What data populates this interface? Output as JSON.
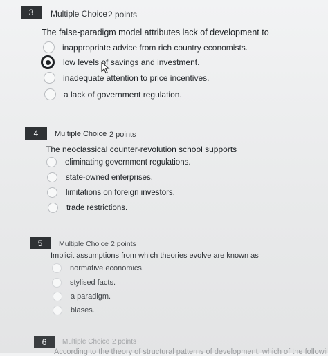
{
  "questions": [
    {
      "number": "3",
      "type": "Multiple Choice",
      "points": "2 points",
      "text": "The false-paradigm model attributes lack of development to",
      "options": [
        "inappropriate advice from rich country economists.",
        "low levels of savings and investment.",
        "inadequate attention to price incentives.",
        "a lack of government regulation."
      ],
      "selected_index": 1
    },
    {
      "number": "4",
      "type": "Multiple Choice",
      "points": "2 points",
      "text": "The neoclassical counter-revolution school supports",
      "options": [
        "eliminating government regulations.",
        "state-owned enterprises.",
        "limitations on foreign investors.",
        "trade restrictions."
      ],
      "selected_index": null
    },
    {
      "number": "5",
      "type": "Multiple Choice",
      "points": "2 points",
      "text": "Implicit assumptions from which theories evolve are known as",
      "options": [
        "normative economics.",
        "stylised facts.",
        "a paradigm.",
        "biases."
      ],
      "selected_index": null
    },
    {
      "number": "6",
      "type": "Multiple Choice",
      "points": "2 points",
      "text": "According to the theory of structural patterns of development, which of the following tends to",
      "options": [],
      "selected_index": null
    }
  ],
  "colors": {
    "number_badge_bg": "#2f3235",
    "selected_radio": "#1f2226",
    "unselected_radio_border": "#b9bcc0"
  }
}
